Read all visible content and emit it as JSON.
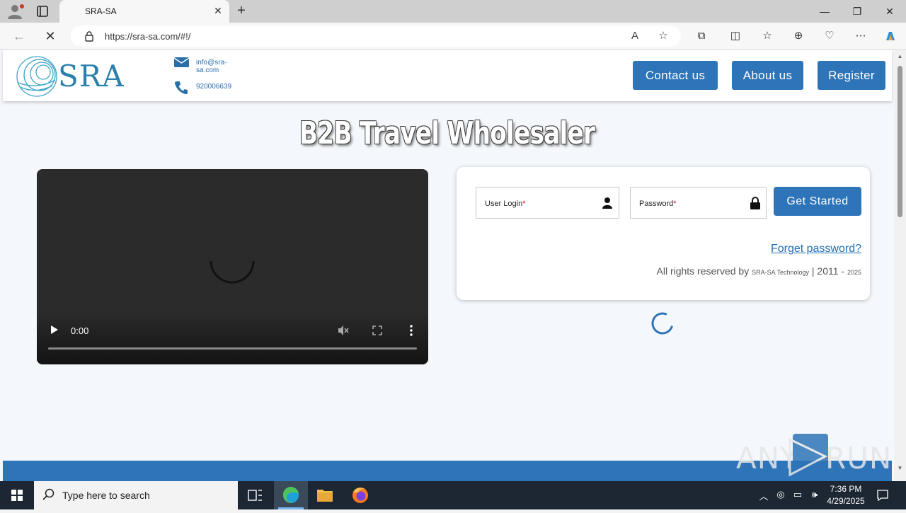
{
  "browser": {
    "tab_title": "SRA-SA",
    "url": "https://sra-sa.com/#!/"
  },
  "header": {
    "logo_text": "SRA",
    "email": "info@sra-sa.com",
    "phone": "920006639",
    "buttons": {
      "contact": "Contact us",
      "about": "About us",
      "register": "Register"
    }
  },
  "hero": {
    "title": "B2B Travel Wholesaler"
  },
  "video": {
    "time": "0:00",
    "progress": 0
  },
  "login": {
    "user_label": "User Login",
    "password_label": "Password",
    "required_mark": "*",
    "submit": "Get Started",
    "forget": "Forget password?",
    "rights_prefix": "All rights reserved by",
    "rights_company": "SRA-SA Technology",
    "rights_sep": "| 2011 -",
    "rights_year": "2025"
  },
  "watermark": {
    "left": "ANY",
    "right": "RUN"
  },
  "taskbar": {
    "search_placeholder": "Type here to search",
    "time": "7:36 PM",
    "date": "4/29/2025"
  },
  "colors": {
    "brand_blue": "#2e74b8",
    "link_blue": "#1f6eb6",
    "required_red": "#d0021b"
  }
}
